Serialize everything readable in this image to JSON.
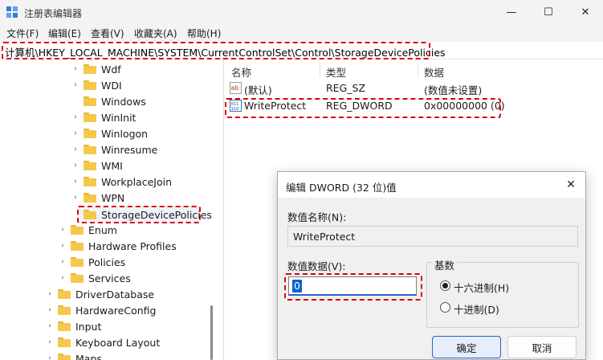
{
  "window": {
    "title": "注册表编辑器",
    "minimize_glyph": "—",
    "maximize_glyph": "☐",
    "close_glyph": "✕"
  },
  "menu": [
    "文件(F)",
    "编辑(E)",
    "查看(V)",
    "收藏夹(A)",
    "帮助(H)"
  ],
  "address": "计算机\\HKEY_LOCAL_MACHINE\\SYSTEM\\CurrentControlSet\\Control\\StorageDevicePolicies",
  "tree": {
    "items": [
      {
        "label": "Wdf",
        "expander": "›"
      },
      {
        "label": "WDI",
        "expander": "›"
      },
      {
        "label": "Windows",
        "expander": ""
      },
      {
        "label": "WinInit",
        "expander": "›"
      },
      {
        "label": "Winlogon",
        "expander": "›"
      },
      {
        "label": "Winresume",
        "expander": "›"
      },
      {
        "label": "WMI",
        "expander": "›"
      },
      {
        "label": "WorkplaceJoin",
        "expander": "›"
      },
      {
        "label": "WPN",
        "expander": "›"
      },
      {
        "label": "StorageDevicePolicies",
        "expander": ""
      },
      {
        "label": "Enum",
        "expander": "›"
      },
      {
        "label": "Hardware Profiles",
        "expander": "›"
      },
      {
        "label": "Policies",
        "expander": "›"
      },
      {
        "label": "Services",
        "expander": "›"
      },
      {
        "label": "DriverDatabase",
        "expander": "›"
      },
      {
        "label": "HardwareConfig",
        "expander": "›"
      },
      {
        "label": "Input",
        "expander": "›"
      },
      {
        "label": "Keyboard Layout",
        "expander": "›"
      },
      {
        "label": "Maps",
        "expander": "›"
      }
    ]
  },
  "list": {
    "headers": {
      "name": "名称",
      "type": "类型",
      "data": "数据"
    },
    "rows": [
      {
        "name": "(默认)",
        "type": "REG_SZ",
        "data": "(数值未设置)",
        "icon": "string-value-icon"
      },
      {
        "name": "WriteProtect",
        "type": "REG_DWORD",
        "data": "0x00000000 (0)",
        "icon": "dword-value-icon"
      }
    ]
  },
  "dialog": {
    "title": "编辑 DWORD (32 位)值",
    "close_glyph": "✕",
    "name_label": "数值名称(N):",
    "name_value": "WriteProtect",
    "data_label": "数值数据(V):",
    "data_value": "0",
    "base_label": "基数",
    "base_options": [
      {
        "label": "十六进制(H)",
        "selected": true
      },
      {
        "label": "十进制(D)",
        "selected": false
      }
    ],
    "ok_label": "确定",
    "cancel_label": "取消"
  },
  "colors": {
    "highlight": "#e00000",
    "folder": "#f5c84c",
    "focus": "#2a62c9"
  }
}
